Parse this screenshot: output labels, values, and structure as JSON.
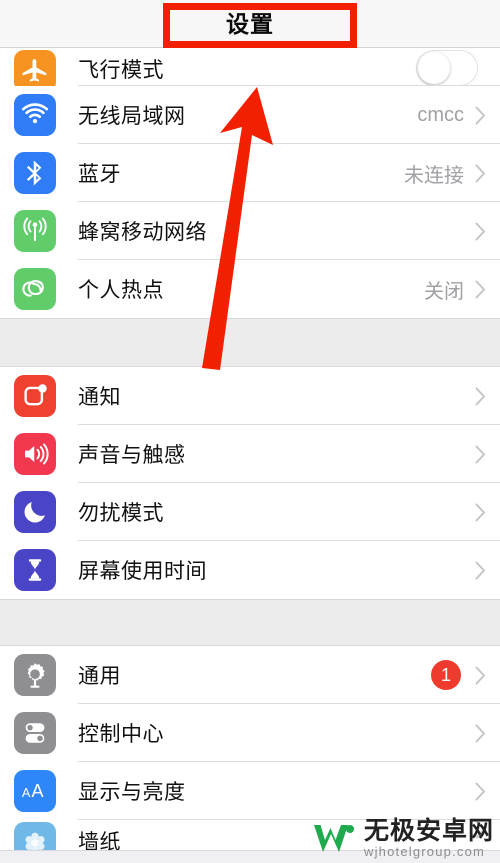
{
  "navbar": {
    "title": "设置"
  },
  "groups": [
    {
      "name": "connectivity",
      "rows": [
        {
          "label": "飞行模式",
          "icon": "airplane-icon",
          "icon_color": "#f79421",
          "accessory": "toggle",
          "toggle_on": false,
          "value": "",
          "clipped": "top"
        },
        {
          "label": "无线局域网",
          "icon": "wifi-icon",
          "icon_color": "#2f7cf6",
          "accessory": "chevron",
          "value": "cmcc"
        },
        {
          "label": "蓝牙",
          "icon": "bluetooth-icon",
          "icon_color": "#2f7cf6",
          "accessory": "chevron",
          "value": "未连接"
        },
        {
          "label": "蜂窝移动网络",
          "icon": "cellular-icon",
          "icon_color": "#60cc6a",
          "accessory": "chevron",
          "value": ""
        },
        {
          "label": "个人热点",
          "icon": "hotspot-icon",
          "icon_color": "#60cc6a",
          "accessory": "chevron",
          "value": "关闭"
        }
      ]
    },
    {
      "name": "alerts",
      "rows": [
        {
          "label": "通知",
          "icon": "notifications-icon",
          "icon_color": "#f0402f",
          "accessory": "chevron",
          "value": ""
        },
        {
          "label": "声音与触感",
          "icon": "sounds-icon",
          "icon_color": "#f1384f",
          "accessory": "chevron",
          "value": ""
        },
        {
          "label": "勿扰模式",
          "icon": "do-not-disturb-icon",
          "icon_color": "#4a44c6",
          "accessory": "chevron",
          "value": ""
        },
        {
          "label": "屏幕使用时间",
          "icon": "screen-time-icon",
          "icon_color": "#4a44c6",
          "accessory": "chevron",
          "value": ""
        }
      ]
    },
    {
      "name": "system",
      "rows": [
        {
          "label": "通用",
          "icon": "gear-icon",
          "icon_color": "#8e8e93",
          "accessory": "chevron",
          "value": "",
          "badge": "1"
        },
        {
          "label": "控制中心",
          "icon": "control-center-icon",
          "icon_color": "#8e8e93",
          "accessory": "chevron",
          "value": ""
        },
        {
          "label": "显示与亮度",
          "icon": "display-brightness-icon",
          "icon_color": "#2f86f6",
          "accessory": "chevron",
          "value": ""
        },
        {
          "label": "墙纸",
          "icon": "wallpaper-icon",
          "icon_color": "#6fb8e8",
          "accessory": "chevron",
          "value": "",
          "clipped": "bottom"
        }
      ]
    }
  ],
  "annotations": {
    "highlight_box": {
      "name": "title-highlight-box",
      "color": "#f32000"
    },
    "arrow": {
      "name": "pointer-arrow",
      "color": "#f32000",
      "direction": "up"
    }
  },
  "watermark": {
    "site_name": "无极安卓网",
    "url": "wjhotelgroup.com",
    "logo_color": "#1faa4e"
  }
}
